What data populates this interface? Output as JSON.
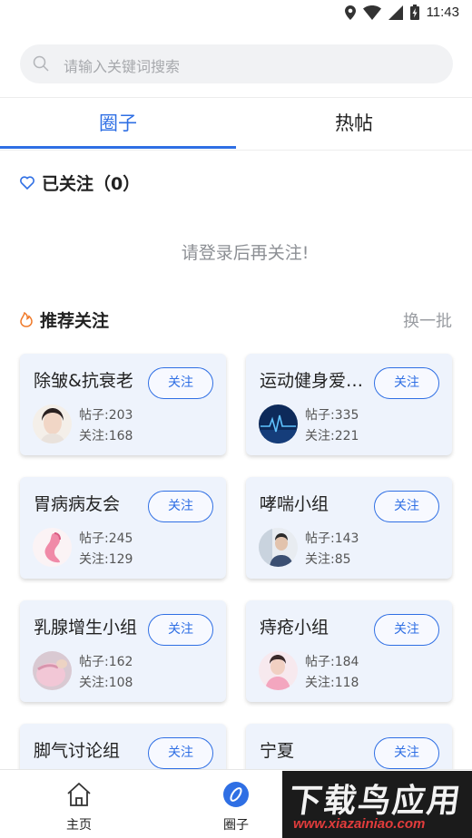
{
  "status_bar": {
    "time": "11:43"
  },
  "search": {
    "placeholder": "请输入关键词搜索"
  },
  "tabs": [
    {
      "label": "圈子",
      "active": true
    },
    {
      "label": "热帖",
      "active": false
    }
  ],
  "followed": {
    "title": "已关注（0）",
    "login_tip": "请登录后再关注!"
  },
  "recommend": {
    "title": "推荐关注",
    "refresh_label": "换一批"
  },
  "groups": [
    {
      "name": "除皱&抗衰老",
      "posts": "帖子:203",
      "fans": "关注:168",
      "button": "关注"
    },
    {
      "name": "运动健身爱好者",
      "posts": "帖子:335",
      "fans": "关注:221",
      "button": "关注"
    },
    {
      "name": "胃病病友会",
      "posts": "帖子:245",
      "fans": "关注:129",
      "button": "关注"
    },
    {
      "name": "哮喘小组",
      "posts": "帖子:143",
      "fans": "关注:85",
      "button": "关注"
    },
    {
      "name": "乳腺增生小组",
      "posts": "帖子:162",
      "fans": "关注:108",
      "button": "关注"
    },
    {
      "name": "痔疮小组",
      "posts": "帖子:184",
      "fans": "关注:118",
      "button": "关注"
    },
    {
      "name": "脚气讨论组",
      "posts": "",
      "fans": "",
      "button": "关注"
    },
    {
      "name": "宁夏",
      "posts": "",
      "fans": "",
      "button": "关注"
    }
  ],
  "bottom_nav": [
    {
      "label": "主页",
      "icon": "home-icon"
    },
    {
      "label": "圈子",
      "icon": "compass-icon",
      "active": true
    }
  ],
  "watermark": {
    "main": "下载鸟应用",
    "url": "www.xiazainiao.com"
  },
  "colors": {
    "accent": "#2f6fe4",
    "card_bg": "#eef3fc",
    "fire": "#f07a2a"
  }
}
